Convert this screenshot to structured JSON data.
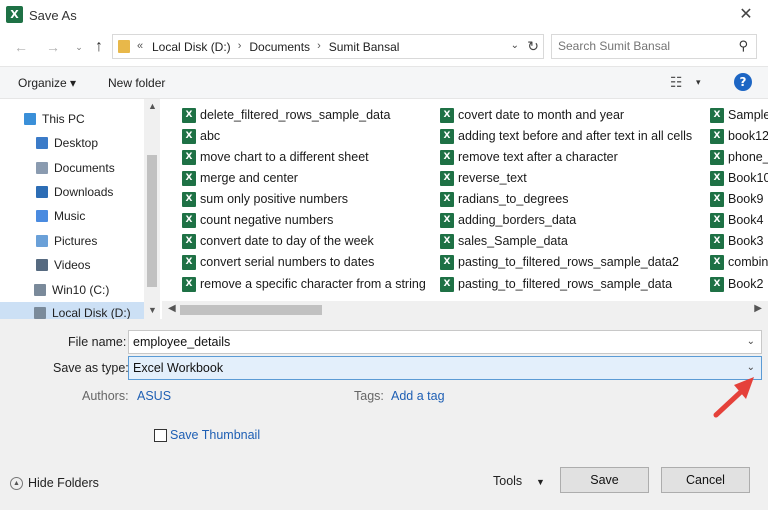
{
  "window": {
    "title": "Save As",
    "app_icon_letter": "X",
    "close_glyph": "✕"
  },
  "nav": {
    "back_glyph": "←",
    "forward_glyph": "→",
    "recent_glyph": "⌄",
    "up_glyph": "↑",
    "address": {
      "prefix": "«",
      "crumbs": [
        "Local Disk (D:)",
        "Documents",
        "Sumit Bansal"
      ],
      "separator": "›",
      "drop_glyph": "⌄",
      "refresh_glyph": "↻"
    },
    "search": {
      "placeholder": "Search Sumit Bansal",
      "icon_glyph": "⚲"
    }
  },
  "toolbar": {
    "organize": "Organize ▾",
    "new_folder": "New folder",
    "view_glyph": "☷",
    "view_drop": "▾",
    "help": "?"
  },
  "navpane": {
    "items": [
      {
        "label": "This PC",
        "icon": "computer-icon"
      },
      {
        "label": "Desktop",
        "icon": "desktop-icon"
      },
      {
        "label": "Documents",
        "icon": "documents-icon"
      },
      {
        "label": "Downloads",
        "icon": "downloads-icon"
      },
      {
        "label": "Music",
        "icon": "music-icon"
      },
      {
        "label": "Pictures",
        "icon": "pictures-icon"
      },
      {
        "label": "Videos",
        "icon": "videos-icon"
      },
      {
        "label": "Win10 (C:)",
        "icon": "drive-icon"
      },
      {
        "label": "Local Disk (D:)",
        "icon": "drive-icon",
        "selected": true
      }
    ],
    "scroll_up": "▲",
    "scroll_down": "▼"
  },
  "files": {
    "icon_letter": "X",
    "columns": [
      [
        "delete_filtered_rows_sample_data",
        "abc",
        "move chart to a different sheet",
        "merge and center",
        "sum only positive numbers",
        "count negative numbers",
        "convert date to day of the week",
        "convert serial numbers to dates",
        "remove a specific character from a string"
      ],
      [
        "covert date to month and year",
        "adding text before and after text in all cells",
        "remove text after a character",
        "reverse_text",
        "radians_to_degrees",
        "adding_borders_data",
        "sales_Sample_data",
        "pasting_to_filtered_rows_sample_data2",
        "pasting_to_filtered_rows_sample_data"
      ],
      [
        "Sample",
        "book12",
        "phone_",
        "Book10",
        "Book9",
        "Book4",
        "Book3",
        "combin",
        "Book2"
      ]
    ],
    "hscroll_left": "◀",
    "hscroll_right": "▶"
  },
  "form": {
    "file_name_label": "File name:",
    "file_name_value": "employee_details",
    "save_type_label": "Save as type:",
    "save_type_value": "Excel Workbook",
    "drop_glyph": "⌄",
    "authors_label": "Authors:",
    "authors_value": "ASUS",
    "tags_label": "Tags:",
    "tags_value": "Add a tag",
    "thumbnail_label": "Save Thumbnail",
    "thumbnail_checked": false
  },
  "footer": {
    "hide_folders": "Hide Folders",
    "hide_glyph": "▲",
    "tools": "Tools",
    "tools_drop": "▼",
    "save": "Save",
    "cancel": "Cancel"
  },
  "colors": {
    "accent": "#1d66c4",
    "excel_green": "#1e7145",
    "link": "#1e5fb4",
    "annotation_arrow": "#e5413a"
  }
}
